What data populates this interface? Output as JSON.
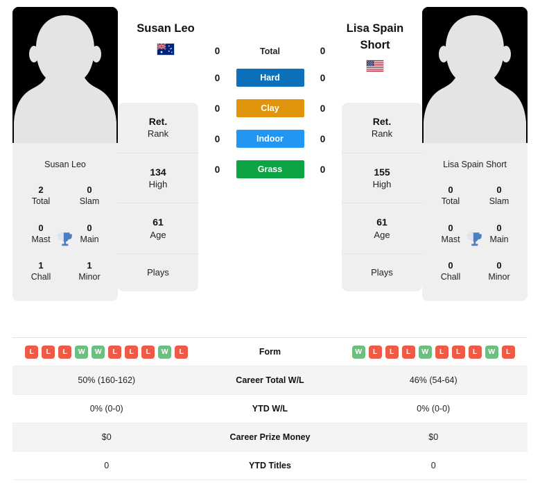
{
  "players": {
    "left": {
      "name": "Susan Leo",
      "photo_caption": "Susan Leo",
      "flag": "australia-flag",
      "trophies": [
        {
          "num": "2",
          "label": "Total"
        },
        {
          "num": "0",
          "label": "Slam"
        },
        {
          "num": "0",
          "label": "Mast"
        },
        {
          "num": "0",
          "label": "Main"
        },
        {
          "num": "1",
          "label": "Chall"
        },
        {
          "num": "1",
          "label": "Minor"
        }
      ],
      "ranking": [
        {
          "num": "Ret.",
          "label": "Rank"
        },
        {
          "num": "134",
          "label": "High"
        },
        {
          "num": "61",
          "label": "Age"
        },
        {
          "num": "",
          "label": "Plays"
        }
      ],
      "form": [
        "L",
        "L",
        "L",
        "W",
        "W",
        "L",
        "L",
        "L",
        "W",
        "L"
      ]
    },
    "right": {
      "name": "Lisa Spain Short",
      "photo_caption": "Lisa Spain Short",
      "flag": "usa-flag",
      "trophies": [
        {
          "num": "0",
          "label": "Total"
        },
        {
          "num": "0",
          "label": "Slam"
        },
        {
          "num": "0",
          "label": "Mast"
        },
        {
          "num": "0",
          "label": "Main"
        },
        {
          "num": "0",
          "label": "Chall"
        },
        {
          "num": "0",
          "label": "Minor"
        }
      ],
      "ranking": [
        {
          "num": "Ret.",
          "label": "Rank"
        },
        {
          "num": "155",
          "label": "High"
        },
        {
          "num": "61",
          "label": "Age"
        },
        {
          "num": "",
          "label": "Plays"
        }
      ],
      "form": [
        "W",
        "L",
        "L",
        "L",
        "W",
        "L",
        "L",
        "L",
        "W",
        "L"
      ]
    }
  },
  "head_to_head": [
    {
      "label": "Total",
      "left": "0",
      "right": "0",
      "pill": false,
      "color": ""
    },
    {
      "label": "Hard",
      "left": "0",
      "right": "0",
      "pill": true,
      "color": "#0d70ba"
    },
    {
      "label": "Clay",
      "left": "0",
      "right": "0",
      "pill": true,
      "color": "#e0930c"
    },
    {
      "label": "Indoor",
      "left": "0",
      "right": "0",
      "pill": true,
      "color": "#2196f3"
    },
    {
      "label": "Grass",
      "left": "0",
      "right": "0",
      "pill": true,
      "color": "#0ea343"
    }
  ],
  "stats": [
    {
      "label": "Form",
      "left": "",
      "right": "",
      "type": "form",
      "alt": false
    },
    {
      "label": "Career Total W/L",
      "left": "50% (160-162)",
      "right": "46% (54-64)",
      "type": "text",
      "alt": true
    },
    {
      "label": "YTD W/L",
      "left": "0% (0-0)",
      "right": "0% (0-0)",
      "type": "text",
      "alt": false
    },
    {
      "label": "Career Prize Money",
      "left": "$0",
      "right": "$0",
      "type": "text",
      "alt": true
    },
    {
      "label": "YTD Titles",
      "left": "0",
      "right": "0",
      "type": "text",
      "alt": false
    }
  ],
  "colors": {
    "win": "#6cbf7e",
    "loss": "#ef5a46",
    "trophy": "#4a7fc1",
    "card_bg": "#efefef"
  }
}
